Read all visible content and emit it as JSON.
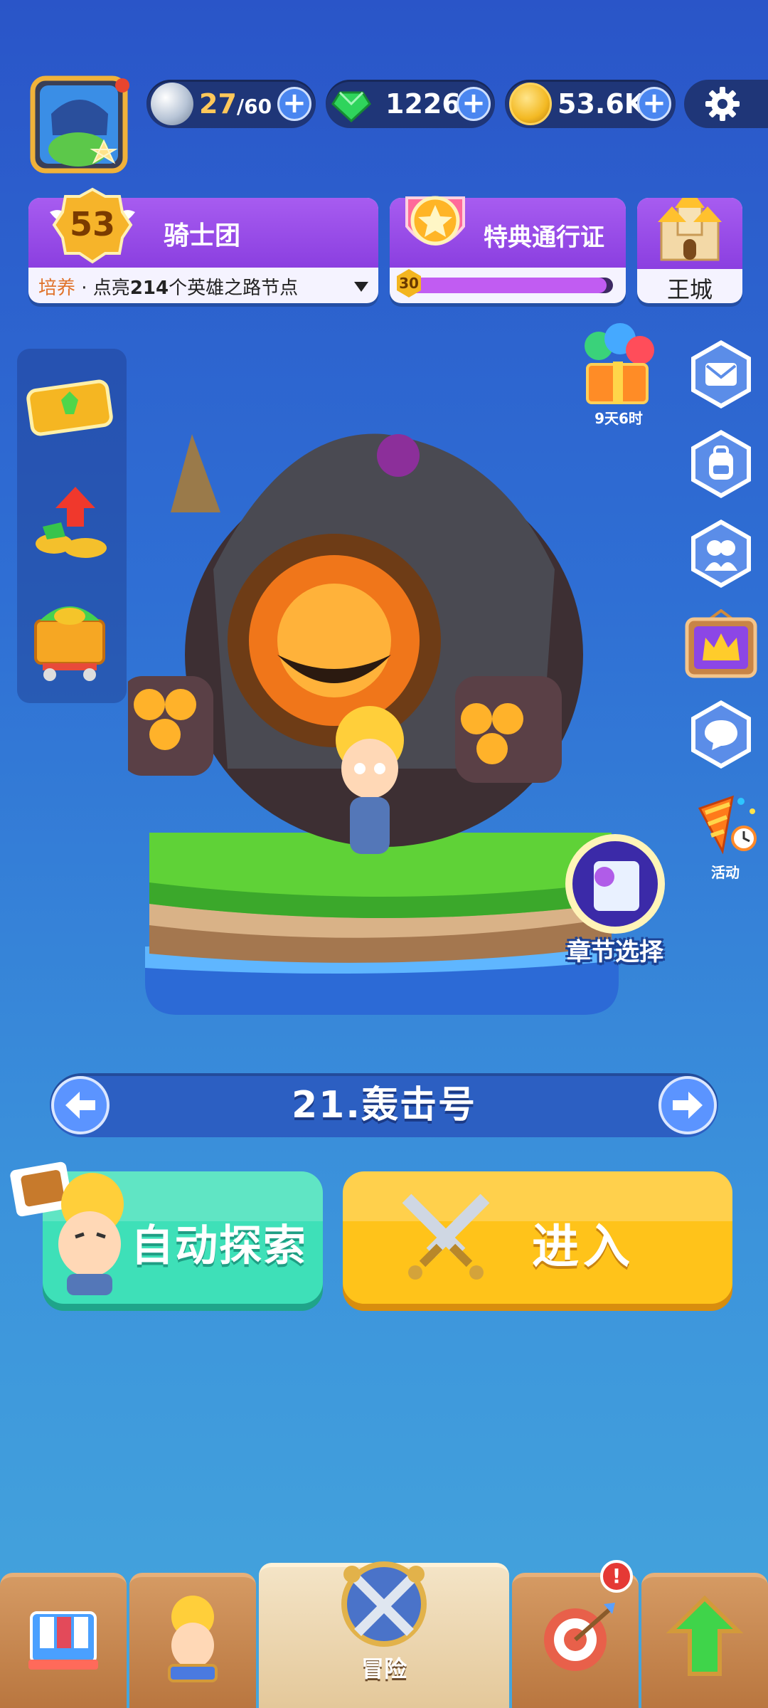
{
  "resources": {
    "energy": {
      "current": "27",
      "max": "/60",
      "icon": "silver-orb-icon"
    },
    "gems": {
      "value": "1226",
      "icon": "green-gem-icon"
    },
    "coins": {
      "value": "53.6K",
      "icon": "gold-coin-icon"
    }
  },
  "settings_icon": "gear-icon",
  "knights": {
    "level": "53",
    "title": "骑士团",
    "hint_prefix": "培养",
    "hint_main": " · 点亮",
    "hint_num": "214",
    "hint_rest": "个英雄之路节点"
  },
  "pass": {
    "title": "特典通行证",
    "level": "30",
    "progress": 0.97
  },
  "castle": {
    "label": "王城"
  },
  "gift": {
    "timer": "9天6时"
  },
  "event": {
    "label": "活动"
  },
  "chapter_select": {
    "label": "章节选择"
  },
  "stage": {
    "name": "21.轰击号"
  },
  "buttons": {
    "auto": "自动探索",
    "enter": "进入"
  },
  "nav": {
    "adventure": "冒险",
    "badge": "!"
  },
  "colors": {
    "auto_btn": "#3ee0b8",
    "enter_btn": "#ffc31a",
    "purple": "#9b4ce8"
  }
}
